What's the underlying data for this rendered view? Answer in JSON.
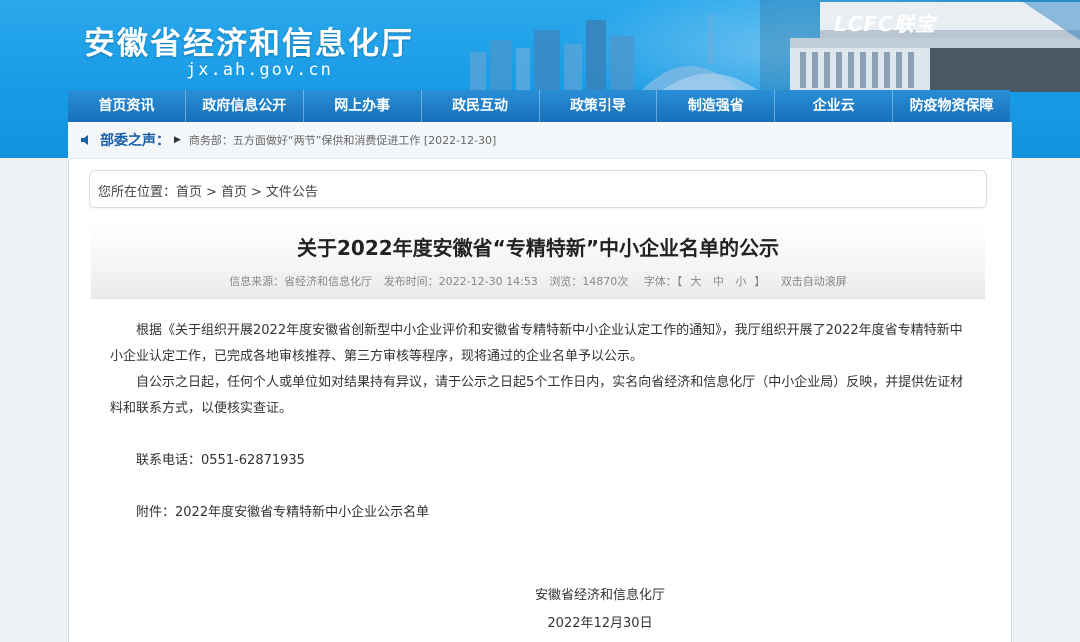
{
  "header": {
    "site_title": "安徽省经济和信息化厅",
    "site_url": "jx.ah.gov.cn",
    "building_sign": "LCFC联宝"
  },
  "nav": {
    "items": [
      "首页资讯",
      "政府信息公开",
      "网上办事",
      "政民互动",
      "政策引导",
      "制造强省",
      "企业云",
      "防疫物资保障"
    ]
  },
  "notice": {
    "title": "部委之声：",
    "text": "商务部：五方面做好“两节”保供和消费促进工作 [2022-12-30]"
  },
  "breadcrumb": {
    "prefix": "您所在位置：",
    "items": [
      "首页",
      "首页",
      "文件公告"
    ]
  },
  "article": {
    "title": "关于2022年度安徽省“专精特新”中小企业名单的公示",
    "meta": {
      "source": "信息来源：省经济和信息化厅",
      "time": "发布时间：2022-12-30 14:53",
      "views": "浏览：14870次",
      "font_label": "字体：【",
      "font_large": "大",
      "font_medium": "中",
      "font_small": "小",
      "font_close": "】",
      "autoscroll": "双击自动滚屏"
    },
    "paragraphs": [
      "根据《关于组织开展2022年度安徽省创新型中小企业评价和安徽省专精特新中小企业认定工作的通知》，我厅组织开展了2022年度省专精特新中小企业认定工作，已完成各地审核推荐、第三方审核等程序，现将通过的企业名单予以公示。",
      "自公示之日起，任何个人或单位如对结果持有异议，请于公示之日起5个工作日内，实名向省经济和信息化厅（中小企业局）反映，并提供佐证材料和联系方式，以便核实查证。"
    ],
    "contact": "联系电话：0551-62871935",
    "attachment": "附件：2022年度安徽省专精特新中小企业公示名单",
    "sign_org": "安徽省经济和信息化厅",
    "sign_date": "2022年12月30日"
  },
  "colors": {
    "banner": "#179ae5",
    "nav": "#166fb8",
    "notice_title": "#1a5ea8"
  }
}
